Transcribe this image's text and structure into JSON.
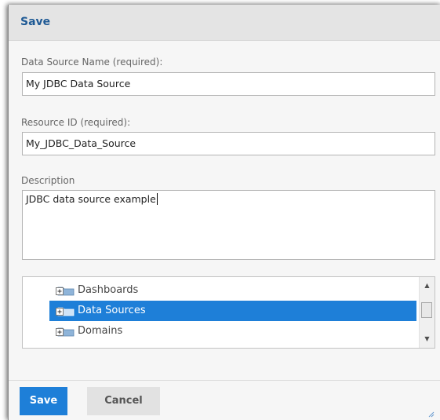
{
  "dialog": {
    "title": "Save"
  },
  "form": {
    "name_label": "Data Source Name (required):",
    "name_value": "My JDBC Data Source",
    "id_label": "Resource ID (required):",
    "id_value": "My_JDBC_Data_Source",
    "description_label": "Description",
    "description_value": "JDBC data source example"
  },
  "tree": {
    "items": [
      {
        "label": "Dashboards",
        "icon": "folder-expand-icon",
        "selected": false
      },
      {
        "label": "Data Sources",
        "icon": "folder-expand-icon",
        "selected": true
      },
      {
        "label": "Domains",
        "icon": "folder-expand-icon",
        "selected": false
      }
    ]
  },
  "buttons": {
    "save": "Save",
    "cancel": "Cancel"
  },
  "colors": {
    "accent": "#1e7fd8",
    "title": "#1f5a95",
    "label": "#666666"
  }
}
